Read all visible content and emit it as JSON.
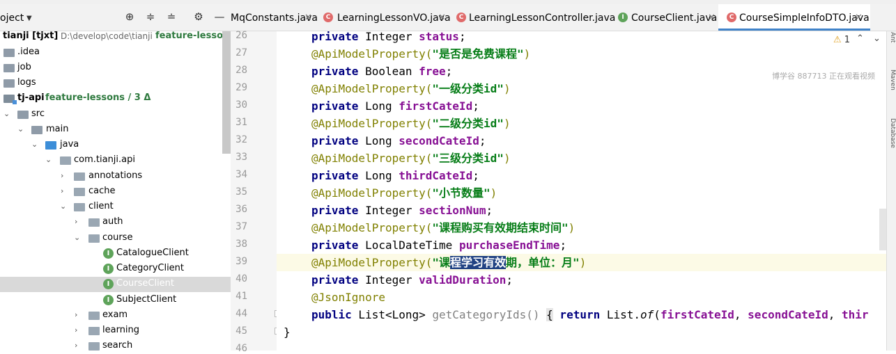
{
  "project_panel": {
    "title": "oject",
    "tree": [
      {
        "label": "tianji [tjxt]",
        "path": "D:\\develop\\code\\tianji",
        "branch": "feature-lessons /",
        "kind": "root"
      },
      {
        "label": ".idea",
        "kind": "folder"
      },
      {
        "label": "job",
        "kind": "folder"
      },
      {
        "label": "logs",
        "kind": "folder"
      },
      {
        "label": "tj-api",
        "branch": "feature-lessons / 3 Δ",
        "kind": "module"
      },
      {
        "label": "src",
        "kind": "folder"
      },
      {
        "label": "main",
        "kind": "folder"
      },
      {
        "label": "java",
        "kind": "source"
      },
      {
        "label": "com.tianji.api",
        "kind": "package"
      },
      {
        "label": "annotations",
        "kind": "package"
      },
      {
        "label": "cache",
        "kind": "package"
      },
      {
        "label": "client",
        "kind": "package"
      },
      {
        "label": "auth",
        "kind": "package"
      },
      {
        "label": "course",
        "kind": "package"
      },
      {
        "label": "CatalogueClient",
        "kind": "interface"
      },
      {
        "label": "CategoryClient",
        "kind": "interface"
      },
      {
        "label": "CourseClient",
        "kind": "interface",
        "selected": true
      },
      {
        "label": "SubjectClient",
        "kind": "interface"
      },
      {
        "label": "exam",
        "kind": "package"
      },
      {
        "label": "learning",
        "kind": "package"
      },
      {
        "label": "search",
        "kind": "package"
      }
    ]
  },
  "editor": {
    "tabs": [
      {
        "label": "MqConstants.java",
        "icon": "class-icon"
      },
      {
        "label": "LearningLessonVO.java",
        "icon": "class-icon"
      },
      {
        "label": "LearningLessonController.java",
        "icon": "class-icon"
      },
      {
        "label": "CourseClient.java",
        "icon": "interface-icon"
      },
      {
        "label": "CourseSimpleInfoDTO.java",
        "icon": "class-icon",
        "active": true
      }
    ],
    "warnings": "1",
    "watermark": "博学谷 887713 正在观看视频",
    "line_numbers": [
      "26",
      "27",
      "28",
      "29",
      "30",
      "31",
      "32",
      "33",
      "34",
      "35",
      "36",
      "37",
      "38",
      "39",
      "40",
      "41",
      "44",
      "45",
      "46"
    ],
    "code": {
      "l26": {
        "kw": "private",
        "type": " Integer ",
        "field": "status",
        "end": ";"
      },
      "l27": {
        "ann": "@ApiModelProperty(",
        "str": "\"是否是免费课程\"",
        "end": ")"
      },
      "l28": {
        "kw": "private",
        "type": " Boolean ",
        "field": "free",
        "end": ";"
      },
      "l29": {
        "ann": "@ApiModelProperty(",
        "str": "\"一级分类id\"",
        "end": ")"
      },
      "l30": {
        "kw": "private",
        "type": " Long ",
        "field": "firstCateId",
        "end": ";"
      },
      "l31": {
        "ann": "@ApiModelProperty(",
        "str": "\"二级分类id\"",
        "end": ")"
      },
      "l32": {
        "kw": "private",
        "type": " Long ",
        "field": "secondCateId",
        "end": ";"
      },
      "l33": {
        "ann": "@ApiModelProperty(",
        "str": "\"三级分类id\"",
        "end": ")"
      },
      "l34": {
        "kw": "private",
        "type": " Long ",
        "field": "thirdCateId",
        "end": ";"
      },
      "l35": {
        "ann": "@ApiModelProperty(",
        "str": "\"小节数量\"",
        "end": ")"
      },
      "l36": {
        "kw": "private",
        "type": " Integer ",
        "field": "sectionNum",
        "end": ";"
      },
      "l37": {
        "ann": "@ApiModelProperty(",
        "str": "\"课程购买有效期结束时间\"",
        "end": ")"
      },
      "l38": {
        "kw": "private",
        "type": " LocalDateTime ",
        "field": "purchaseEndTime",
        "end": ";"
      },
      "l39": {
        "ann": "@ApiModelProperty(",
        "str_a": "\"课",
        "str_sel": "程学习有效",
        "str_b": "期，单位：月\"",
        "end": ")"
      },
      "l40": {
        "kw": "private",
        "type": " Integer ",
        "field": "validDuration",
        "end": ";"
      },
      "l41": {
        "ann": "@JsonIgnore"
      },
      "l44": {
        "kw": "public",
        "type": " List<Long> ",
        "method": "getCategoryIds",
        "paren": "() ",
        "brace": "{",
        "ret": " return",
        "call_a": " List.",
        "call_of": "of",
        "call_b": "(",
        "f1": "firstCateId",
        "sep1": ", ",
        "f2": "secondCateId",
        "sep2": ", ",
        "f3": "thir"
      },
      "l45": {
        "end": "}"
      }
    }
  },
  "right_strip": [
    "Ant",
    "Maven",
    "Database"
  ]
}
